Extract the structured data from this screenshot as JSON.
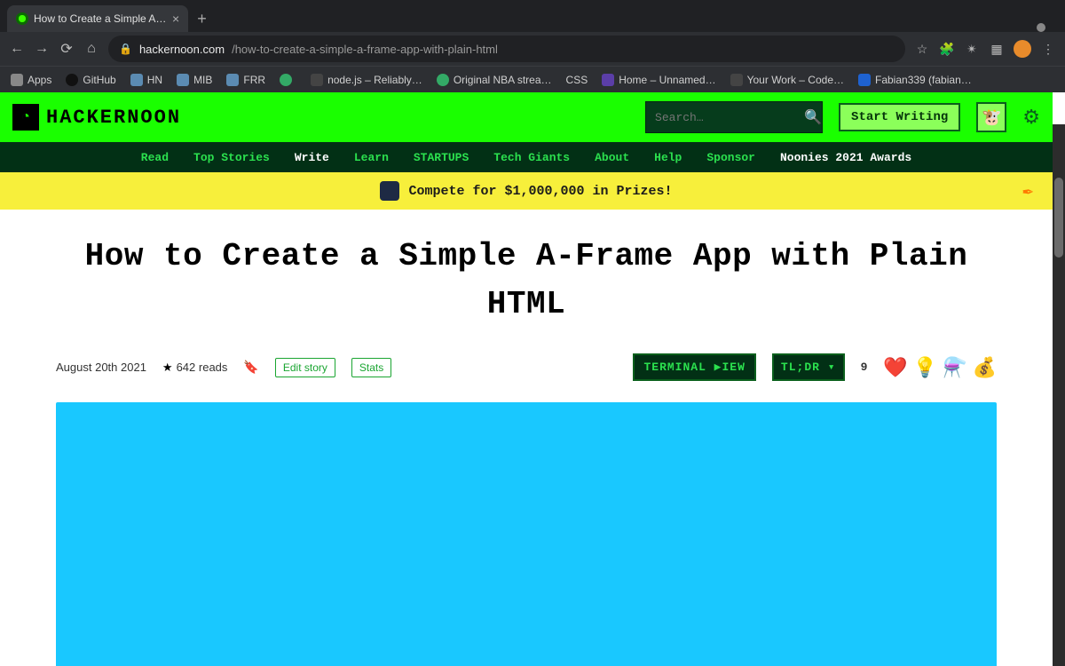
{
  "browser": {
    "tab_title": "How to Create a Simple A-Fr…",
    "url_host": "hackernoon.com",
    "url_path": "/how-to-create-a-simple-a-frame-app-with-plain-html",
    "bookmarks": [
      "Apps",
      "GitHub",
      "HN",
      "MIB",
      "FRR",
      "",
      "node.js – Reliably…",
      "Original NBA strea…",
      "CSS",
      "Home – Unnamed…",
      "Your Work – Code…",
      "Fabian339 (fabian…"
    ]
  },
  "site": {
    "logo_text": "HACKERNOON",
    "search_placeholder": "Search…",
    "start_writing": "Start Writing",
    "nav": [
      "Read",
      "Top Stories",
      "Write",
      "Learn",
      "STARTUPS",
      "Tech Giants",
      "About",
      "Help",
      "Sponsor",
      "Noonies 2021 Awards"
    ],
    "nav_active_index": 2,
    "promo_text": "Compete for $1,000,000 in Prizes!"
  },
  "article": {
    "title": "How to Create a Simple A-Frame App with Plain HTML",
    "date": "August 20th 2021",
    "reads": "642 reads",
    "edit_label": "Edit story",
    "stats_label": "Stats",
    "terminal_view": "TERMINAL ▶IEW",
    "tldr": "TL;DR ▾",
    "reaction_count": "9",
    "reaction_icons": [
      "❤️",
      "💡",
      "⚗️",
      "💰"
    ]
  }
}
